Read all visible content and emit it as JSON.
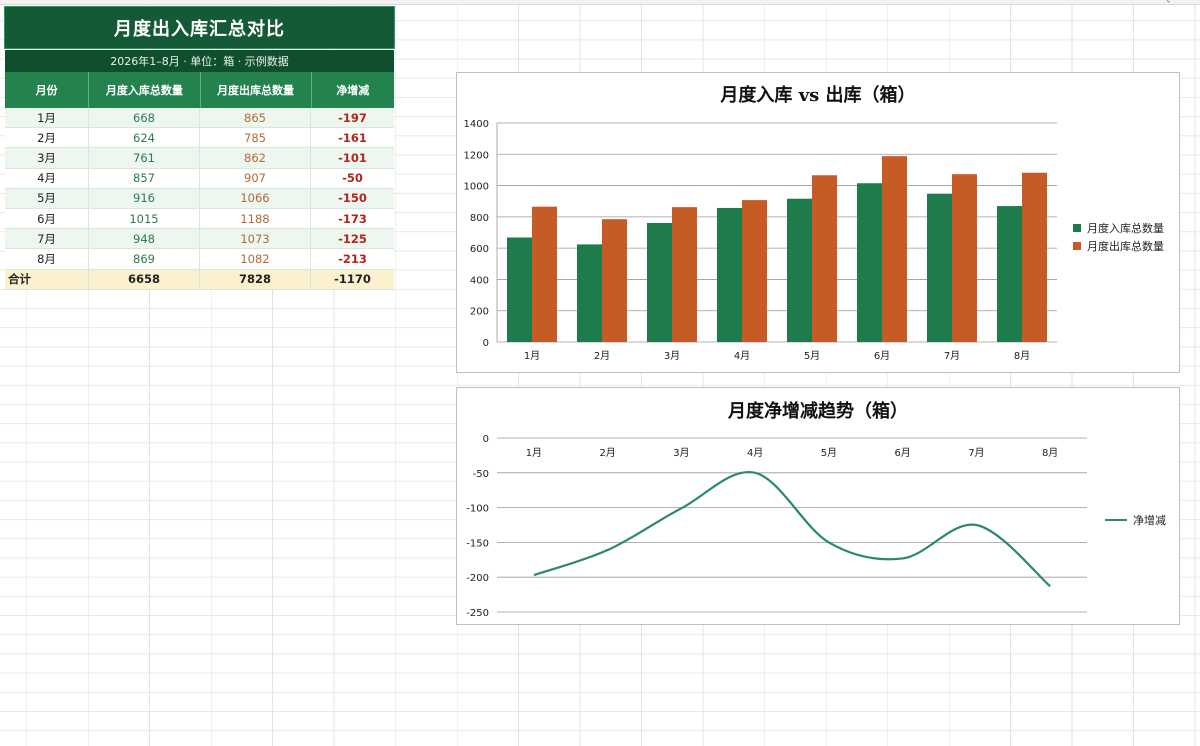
{
  "sheet": {
    "column_letters": [
      "A",
      "B",
      "C",
      "D",
      "E",
      "F",
      "G",
      "H",
      "I",
      "J",
      "K",
      "L",
      "M",
      "N",
      "O",
      "P",
      "Q"
    ]
  },
  "table": {
    "title": "月度出入库汇总对比",
    "subtitle": "2026年1–8月 · 单位：箱 · 示例数据",
    "headers": [
      "月份",
      "月度入库总数量",
      "月度出库总数量",
      "净增减"
    ],
    "rows": [
      {
        "month": "1月",
        "in": "668",
        "out": "865",
        "net": "-197"
      },
      {
        "month": "2月",
        "in": "624",
        "out": "785",
        "net": "-161"
      },
      {
        "month": "3月",
        "in": "761",
        "out": "862",
        "net": "-101"
      },
      {
        "month": "4月",
        "in": "857",
        "out": "907",
        "net": "-50"
      },
      {
        "month": "5月",
        "in": "916",
        "out": "1066",
        "net": "-150"
      },
      {
        "month": "6月",
        "in": "1015",
        "out": "1188",
        "net": "-173"
      },
      {
        "month": "7月",
        "in": "948",
        "out": "1073",
        "net": "-125"
      },
      {
        "month": "8月",
        "in": "869",
        "out": "1082",
        "net": "-213"
      }
    ],
    "total": {
      "label": "合计",
      "in": "6658",
      "out": "7828",
      "net": "-1170"
    }
  },
  "colors": {
    "inbound": "#1e7c4c",
    "outbound": "#c65b25",
    "line": "#2a8a64",
    "axis_label": "#222222",
    "gridline": "#9a9a9a"
  },
  "chart_data": [
    {
      "type": "bar",
      "title": "月度入库 vs 出库（箱）",
      "categories": [
        "1月",
        "2月",
        "3月",
        "4月",
        "5月",
        "6月",
        "7月",
        "8月"
      ],
      "series": [
        {
          "name": "月度入库总数量",
          "values": [
            668,
            624,
            761,
            857,
            916,
            1015,
            948,
            869
          ]
        },
        {
          "name": "月度出库总数量",
          "values": [
            865,
            785,
            862,
            907,
            1066,
            1188,
            1073,
            1082
          ]
        }
      ],
      "ylim": [
        0,
        1400
      ],
      "yticks": [
        "0",
        "200",
        "400",
        "600",
        "800",
        "1000",
        "1200",
        "1400"
      ],
      "grid": true,
      "legend": "right"
    },
    {
      "type": "line",
      "title": "月度净增减趋势（箱）",
      "categories": [
        "1月",
        "2月",
        "3月",
        "4月",
        "5月",
        "6月",
        "7月",
        "8月"
      ],
      "series": [
        {
          "name": "净增减",
          "values": [
            -197,
            -161,
            -101,
            -50,
            -150,
            -173,
            -125,
            -213
          ]
        }
      ],
      "ylim": [
        -250,
        0
      ],
      "yticks": [
        "0",
        "-50",
        "-100",
        "-150",
        "-200",
        "-250"
      ],
      "grid": true,
      "smooth": true,
      "legend": "right"
    }
  ]
}
